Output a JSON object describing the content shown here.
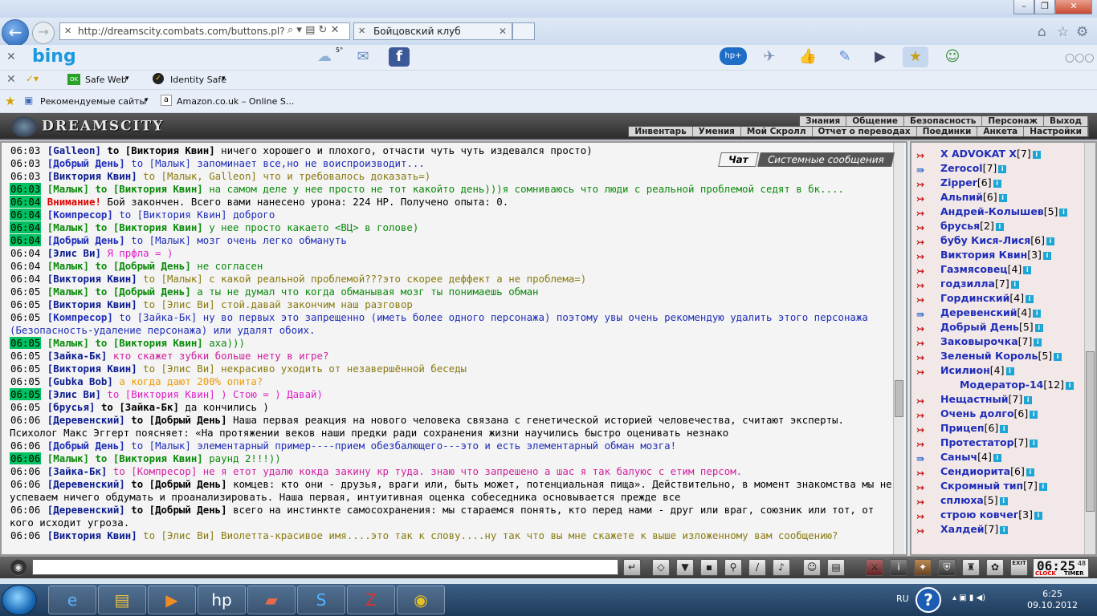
{
  "browser": {
    "address": "http://dreamscity.combats.com/buttons.pl?batt",
    "tab_title": "Бойцовский клуб",
    "bing_logo": "bing",
    "weather": "5°",
    "toolbar2": {
      "safe_web": "Safe Web",
      "identity_safe": "Identity Safe"
    },
    "favorites": {
      "recommended": "Рекомендуемые сайты",
      "amazon": "Amazon.co.uk – Online S..."
    }
  },
  "game": {
    "logo": "DREAMSCITY",
    "menu_top": [
      "Знания",
      "Общение",
      "Безопасность",
      "Персонаж",
      "Выход"
    ],
    "menu_bottom": [
      "Инвентарь",
      "Умения",
      "Мой Скролл",
      "Отчет о переводах",
      "Поединки",
      "Анкета",
      "Настройки"
    ],
    "chat_tabs": {
      "chat": "Чат",
      "system": "Системные сообщения"
    },
    "clock": {
      "time": "06:25",
      "seconds": "48",
      "clock_label": "CLOCK",
      "timer_label": "TIMER"
    },
    "exit_label": "EXIT"
  },
  "chat": [
    {
      "time": "06:03",
      "hl": false,
      "nick": "[Galleon]",
      "target": "to [Виктория Квин]",
      "text": "ничего хорошего и плохого, отчасти чуть чуть издевался просто)",
      "nc": "c-navy",
      "tc": "c-black",
      "xc": "c-black"
    },
    {
      "time": "06:03",
      "hl": false,
      "nick": "[Добрый День]",
      "target": "to [Малык]",
      "text": "запоминает все,но не воиспроизводит...",
      "nc": "c-blue",
      "tc": "c-blue",
      "xc": "c-blue"
    },
    {
      "time": "06:03",
      "hl": false,
      "nick": "[Виктория Квин]",
      "target": "to [Малык, Galleon]",
      "text": "что и требовалось доказать=)",
      "nc": "c-navy",
      "tc": "c-olive",
      "xc": "c-olive"
    },
    {
      "time": "06:03",
      "hl": true,
      "nick": "[Малык]",
      "target": "to [Виктория Квин]",
      "text": "на самом деле у нее просто не тот какойто день)))я сомниваюсь что люди с реальной проблемой седят в бк....",
      "nc": "c-green",
      "tc": "c-green",
      "xc": "c-green"
    },
    {
      "time": "06:04",
      "hl": true,
      "nick": "Внимание!",
      "target": "",
      "text": "Бой закончен. Всего вами нанесено урона: 224 HP. Получено опыта: 0.",
      "nc": "c-red",
      "tc": "c-black",
      "xc": "c-black"
    },
    {
      "time": "06:04",
      "hl": true,
      "nick": "[Компресор]",
      "target": "to [Виктория Квин]",
      "text": "доброго",
      "nc": "c-blue",
      "tc": "c-blue",
      "xc": "c-blue"
    },
    {
      "time": "06:04",
      "hl": true,
      "nick": "[Малык]",
      "target": "to [Виктория Квин]",
      "text": "у нее просто какаето <ВЦ> в голове)",
      "nc": "c-green",
      "tc": "c-green",
      "xc": "c-green"
    },
    {
      "time": "06:04",
      "hl": true,
      "nick": "[Добрый День]",
      "target": "to [Малык]",
      "text": "мозг очень легко обмануть",
      "nc": "c-blue",
      "tc": "c-blue",
      "xc": "c-blue"
    },
    {
      "time": "06:04",
      "hl": false,
      "nick": "[Элис Ви]",
      "target": "",
      "text": "Я прфла = )",
      "nc": "c-navy",
      "tc": "c-magenta",
      "xc": "c-magenta"
    },
    {
      "time": "06:04",
      "hl": false,
      "nick": "[Малык]",
      "target": "to [Добрый День]",
      "text": "не согласен",
      "nc": "c-green",
      "tc": "c-green",
      "xc": "c-green"
    },
    {
      "time": "06:04",
      "hl": false,
      "nick": "[Виктория Квин]",
      "target": "to [Малык]",
      "text": "с какой реальной проблемой???это скорее деффект а не проблема=)",
      "nc": "c-navy",
      "tc": "c-olive",
      "xc": "c-olive"
    },
    {
      "time": "06:05",
      "hl": false,
      "nick": "[Малык]",
      "target": "to [Добрый День]",
      "text": "а ты не думал что когда обманывая мозг ты понимаешь обман",
      "nc": "c-green",
      "tc": "c-green",
      "xc": "c-green"
    },
    {
      "time": "06:05",
      "hl": false,
      "nick": "[Виктория Квин]",
      "target": "to [Элис Ви]",
      "text": "стой.давай закончим наш разговор",
      "nc": "c-navy",
      "tc": "c-olive",
      "xc": "c-olive"
    },
    {
      "time": "06:05",
      "hl": false,
      "nick": "[Компресор]",
      "target": "to [Зайка-Бк]",
      "text": "ну во первых это запрещенно (иметь более одного персонажа) поэтому увы очень рекомендую удалить этого персонажа (Безопасность-удаление персонажа) или удалят обоих.",
      "nc": "c-blue",
      "tc": "c-blue",
      "xc": "c-blue"
    },
    {
      "time": "06:05",
      "hl": true,
      "nick": "[Малык]",
      "target": "to [Виктория Квин]",
      "text": "аха)))",
      "nc": "c-green",
      "tc": "c-green",
      "xc": "c-green"
    },
    {
      "time": "06:05",
      "hl": false,
      "nick": "[Зайка-Бк]",
      "target": "",
      "text": "кто скажет зубки больше нету в игре?",
      "nc": "c-navy",
      "tc": "c-pink",
      "xc": "c-pink"
    },
    {
      "time": "06:05",
      "hl": false,
      "nick": "[Виктория Квин]",
      "target": "to [Элис Ви]",
      "text": "некрасиво уходить от незавершённой беседы",
      "nc": "c-navy",
      "tc": "c-olive",
      "xc": "c-olive"
    },
    {
      "time": "06:05",
      "hl": false,
      "nick": "[Gubka Bob]",
      "target": "",
      "text": "а когда дают 200% опита?",
      "nc": "c-navy",
      "tc": "c-orange",
      "xc": "c-orange"
    },
    {
      "time": "06:05",
      "hl": true,
      "nick": "[Элис Ви]",
      "target": "to [Виктория Квин]",
      "text": ") Стою = ) Давай)",
      "nc": "c-navy",
      "tc": "c-magenta",
      "xc": "c-magenta"
    },
    {
      "time": "06:05",
      "hl": false,
      "nick": "[брусья]",
      "target": "to [Зайка-Бк]",
      "text": "да кончились )",
      "nc": "c-navy",
      "tc": "c-black",
      "xc": "c-black"
    },
    {
      "time": "06:06",
      "hl": false,
      "nick": "[Деревенский]",
      "target": "to [Добрый День]",
      "text": "Наша первая реакция на нового человека связана с генетической историей человечества, считают эксперты. Психолог Макс Эггерт поясняет: «На протяжении веков наши предки ради сохранения жизни научились быстро оценивать незнако",
      "nc": "c-navy",
      "tc": "c-black",
      "xc": "c-black"
    },
    {
      "time": "06:06",
      "hl": false,
      "nick": "[Добрый День]",
      "target": "to [Малык]",
      "text": "элементарный пример----прием обезбалющего---это и есть элементарный обман мозга!",
      "nc": "c-blue",
      "tc": "c-blue",
      "xc": "c-blue"
    },
    {
      "time": "06:06",
      "hl": true,
      "nick": "[Малык]",
      "target": "to [Виктория Квин]",
      "text": "раунд 2!!!))",
      "nc": "c-green",
      "tc": "c-green",
      "xc": "c-green"
    },
    {
      "time": "06:06",
      "hl": false,
      "nick": "[Зайка-Бк]",
      "target": "to [Компресор]",
      "text": "не я етот удалю кокда закину кр туда. знаю что запрешено а шас я так балуюс с етим персом.",
      "nc": "c-navy",
      "tc": "c-pink",
      "xc": "c-pink"
    },
    {
      "time": "06:06",
      "hl": false,
      "nick": "[Деревенский]",
      "target": "to [Добрый День]",
      "text": "комцев: кто они - друзья, враги или, быть может, потенциальная пища». Действительно, в момент знакомства мы не успеваем ничего обдумать и проанализировать. Наша первая, интуитивная оценка собеседника основывается прежде все",
      "nc": "c-navy",
      "tc": "c-black",
      "xc": "c-black"
    },
    {
      "time": "06:06",
      "hl": false,
      "nick": "[Деревенский]",
      "target": "to [Добрый День]",
      "text": "всего на инстинкте самосохранения: мы стараемся понять, кто перед нами - друг или враг, союзник или тот, от кого исходит угроза.",
      "nc": "c-navy",
      "tc": "c-black",
      "xc": "c-black"
    },
    {
      "time": "06:06",
      "hl": false,
      "nick": "[Виктория Квин]",
      "target": "to [Элис Ви]",
      "text": "Виолетта-красивое имя....это так к слову....ну так что вы мне скажете к выше изложенному вам сообщению?",
      "nc": "c-navy",
      "tc": "c-olive",
      "xc": "c-olive"
    }
  ],
  "users": [
    {
      "name": "X ADVOKAT X",
      "level": "[7]"
    },
    {
      "name": "Zerocol",
      "level": "[7]"
    },
    {
      "name": "Zipper",
      "level": "[6]"
    },
    {
      "name": "Альпий",
      "level": "[6]"
    },
    {
      "name": "Андрей-Колышев",
      "level": "[5]"
    },
    {
      "name": "брусья",
      "level": "[2]"
    },
    {
      "name": "бубу Кися-Лися",
      "level": "[6]"
    },
    {
      "name": "Виктория Квин",
      "level": "[3]"
    },
    {
      "name": "Газмясовец",
      "level": "[4]"
    },
    {
      "name": "годзилла",
      "level": "[7]"
    },
    {
      "name": "Гординский",
      "level": "[4]"
    },
    {
      "name": "Деревенский",
      "level": "[4]"
    },
    {
      "name": "Добрый День",
      "level": "[5]"
    },
    {
      "name": "Заковырочка",
      "level": "[7]"
    },
    {
      "name": "Зеленый Король",
      "level": "[5]"
    },
    {
      "name": "Исилион",
      "level": "[4]"
    },
    {
      "name": "Модератор-14",
      "level": "[12]"
    },
    {
      "name": "Нещастный",
      "level": "[7]"
    },
    {
      "name": "Очень долго",
      "level": "[6]"
    },
    {
      "name": "Прицеп",
      "level": "[6]"
    },
    {
      "name": "Протестатор",
      "level": "[7]"
    },
    {
      "name": "Саныч",
      "level": "[4]"
    },
    {
      "name": "Сендиорита",
      "level": "[6]"
    },
    {
      "name": "Скромный тип",
      "level": "[7]"
    },
    {
      "name": "сплюха",
      "level": "[5]"
    },
    {
      "name": "строю ковчег",
      "level": "[3]"
    },
    {
      "name": "Халдей",
      "level": "[7]"
    }
  ],
  "taskbar": {
    "lang": "RU",
    "time": "6:25",
    "date": "09.10.2012"
  }
}
